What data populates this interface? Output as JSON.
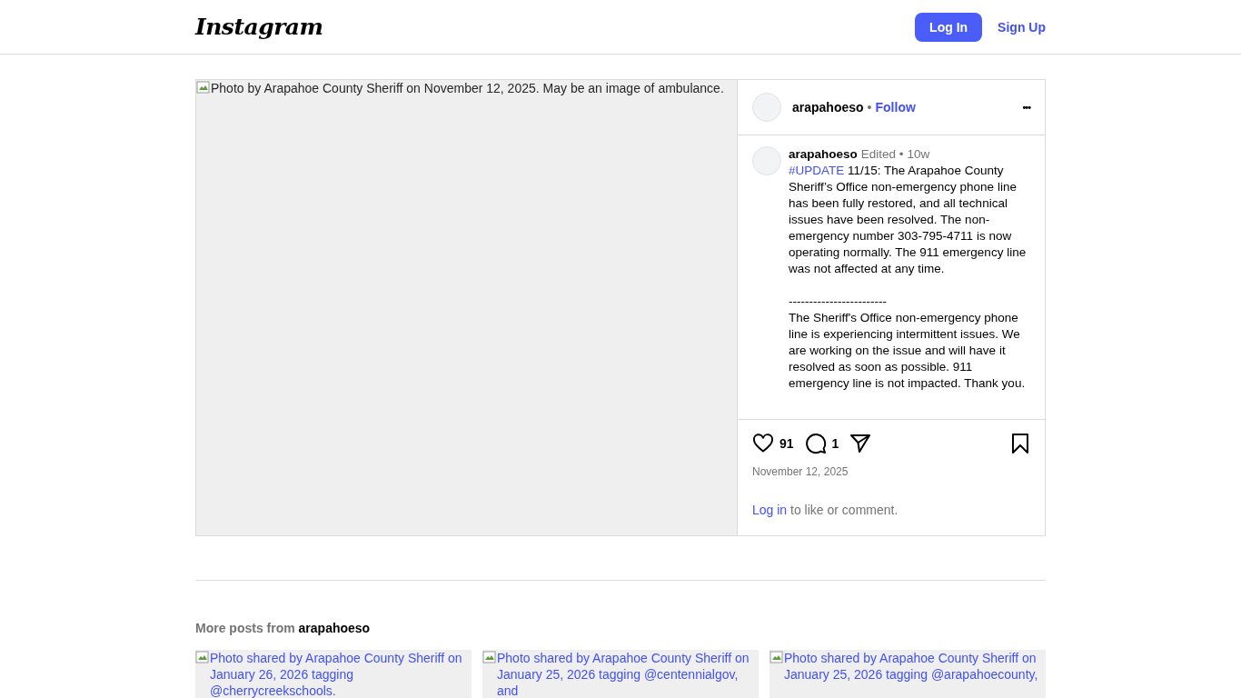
{
  "header": {
    "logo": "Instagram",
    "buttons": [
      {
        "label": "Log In",
        "kind": "primary"
      },
      {
        "label": "Sign Up",
        "kind": "link"
      }
    ]
  },
  "post": {
    "image_alt": "Photo by Arapahoe County Sheriff on November 12, 2025. May be an image of ambulance.",
    "author": {
      "username": "arapahoeso",
      "separator": "•",
      "follow": "Follow",
      "more": "•••"
    },
    "caption": {
      "username": "arapahoeso",
      "edited": "Edited •",
      "age": "10w",
      "hashtag": "#UPDATE",
      "paragraphs": [
        "11/15: The Arapahoe County Sheriff’s Office non-emergency phone line has been fully restored, and all technical issues have been resolved. The non-emergency number 303-795-4711 is now operating normally. The 911 emergency line was not affected at any time.",
        "------------------------",
        "The Sheriff's Office non-emergency phone line is experiencing intermittent issues. We are working on the issue and will have it resolved as soon as possible. 911 emergency line is not impacted. Thank you."
      ]
    },
    "actions": {
      "likes": "91",
      "comments": "1"
    },
    "date": "November 12, 2025",
    "login_prompt": {
      "link": "Log in",
      "text": "to like or comment."
    }
  },
  "more_posts": {
    "label": "More posts from",
    "username": "arapahoeso",
    "tiles": [
      {
        "alt": "Photo shared by Arapahoe County Sheriff on January 26, 2026 tagging @cherrycreekschools."
      },
      {
        "alt": "Photo shared by Arapahoe County Sheriff on January 25, 2026 tagging @centennialgov, and"
      },
      {
        "alt": "Photo shared by Arapahoe County Sheriff on January 25, 2026 tagging @arapahoecounty,"
      }
    ]
  }
}
